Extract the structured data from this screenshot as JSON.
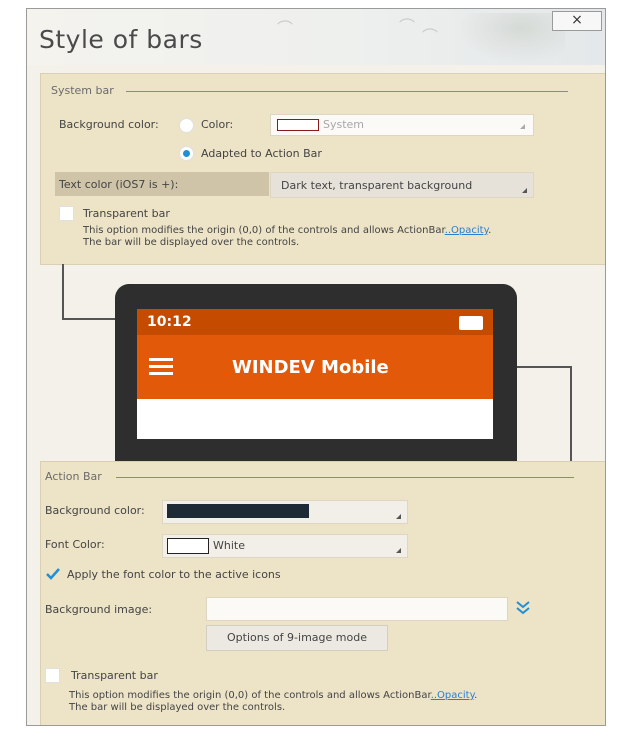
{
  "window": {
    "title": "Style of bars",
    "close_label": "×"
  },
  "system_bar": {
    "legend": "System bar",
    "background_label": "Background color:",
    "color_option": "Color:",
    "color_value": "System",
    "adapted_option": "Adapted to Action Bar",
    "text_color_label": "Text color (iOS7 is +):",
    "text_color_value": "Dark text, transparent background",
    "transparent_label": "Transparent bar",
    "note_line1": "This option modifies the origin (0,0) of the controls and allows ActionBar",
    "note_link": "..Opacity",
    "note_end": ".",
    "note_line2": "The bar will be displayed over the controls."
  },
  "phone": {
    "time": "10:12",
    "app_name": "WINDEV Mobile"
  },
  "action_bar": {
    "legend": "Action Bar",
    "background_label": "Background color:",
    "font_color_label": "Font Color:",
    "font_color_value": "White",
    "apply_icons_label": "Apply the font color to the active icons",
    "background_image_label": "Background image:",
    "nine_image_button": "Options of 9-image mode",
    "transparent_label": "Transparent bar",
    "note_line1": "This option modifies the origin (0,0) of the controls and allows ActionBar",
    "note_link": "..Opacity",
    "note_end": ".",
    "note_line2": "The bar will be displayed over the controls."
  },
  "colors": {
    "accent": "#1f8fd6",
    "action_bar_bg": "#e3590a",
    "status_bar_bg": "#c44b00",
    "panel_bg": "#ede3c7",
    "dark_swatch": "#1e2a35"
  },
  "icons": [
    "close-icon",
    "hamburger-icon",
    "battery-icon",
    "combo-arrow-icon",
    "double-chevron-down-icon",
    "checkmark-icon"
  ]
}
